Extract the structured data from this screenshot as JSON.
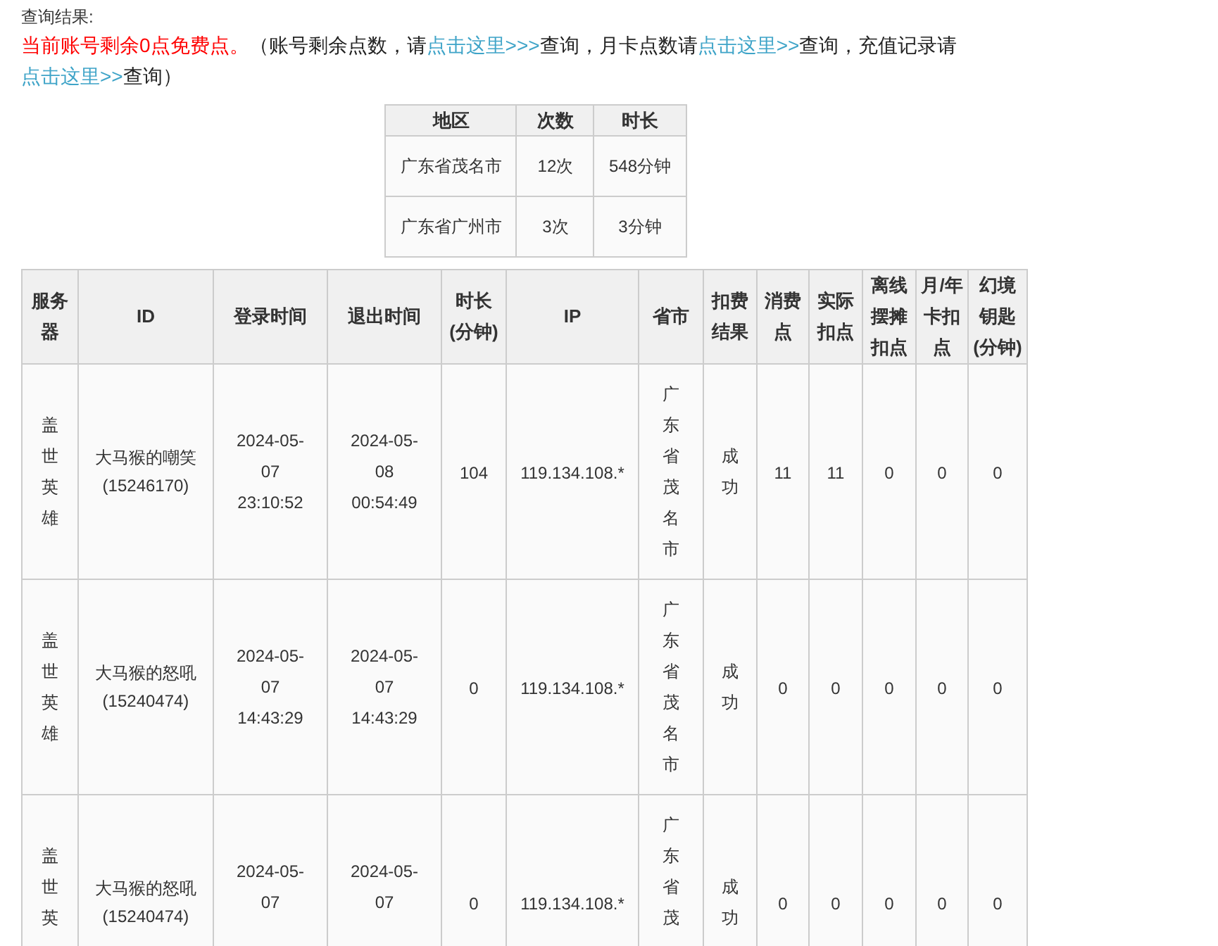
{
  "result_label": "查询结果:",
  "notice": [
    {
      "kind": "alert",
      "text": "当前账号剩余0点免费点。"
    },
    {
      "kind": "text",
      "text": "（账号剩余点数，请"
    },
    {
      "kind": "link",
      "text": "点击这里>>>"
    },
    {
      "kind": "text",
      "text": "查询，月卡点数请"
    },
    {
      "kind": "link",
      "text": "点击这里>>"
    },
    {
      "kind": "text",
      "text": "查询，充值记录请"
    },
    {
      "kind": "link",
      "text": "点击这里>>"
    },
    {
      "kind": "text",
      "text": "查询）"
    }
  ],
  "summary_table": {
    "columns": [
      "地区",
      "次数",
      "时长"
    ],
    "rows": [
      [
        "广东省茂名市",
        "12次",
        "548分钟"
      ],
      [
        "广东省广州市",
        "3次",
        "3分钟"
      ]
    ]
  },
  "login_table": {
    "columns": [
      "服务器",
      "ID",
      "登录时间",
      "退出时间",
      "时长(分钟)",
      "IP",
      "省市",
      "扣费结果",
      "消费点",
      "实际扣点",
      "离线摆摊扣点",
      "月/年卡扣点",
      "幻境钥匙(分钟)"
    ],
    "rows": [
      [
        "盖世英雄",
        "大马猴的嘲笑(15246170)",
        "2024-05-07 23:10:52",
        "2024-05-08 00:54:49",
        "104",
        "119.134.108.*",
        "广东省茂名市",
        "成功",
        "11",
        "11",
        "0",
        "0",
        "0"
      ],
      [
        "盖世英雄",
        "大马猴的怒吼(15240474)",
        "2024-05-07 14:43:29",
        "2024-05-07 14:43:29",
        "0",
        "119.134.108.*",
        "广东省茂名市",
        "成功",
        "0",
        "0",
        "0",
        "0",
        "0"
      ],
      [
        "盖世英",
        "大马猴的怒吼(15240474)",
        "2024-05-07",
        "2024-05-07",
        "0",
        "119.134.108.*",
        "广东省茂",
        "成功",
        "0",
        "0",
        "0",
        "0",
        "0"
      ]
    ]
  }
}
